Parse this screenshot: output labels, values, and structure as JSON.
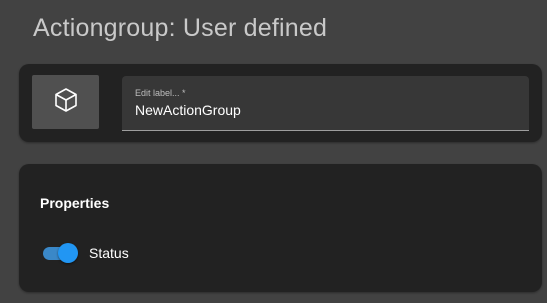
{
  "header": {
    "title": "Actiongroup: User defined"
  },
  "label_panel": {
    "icon": "cube-icon",
    "field": {
      "label": "Edit label... *",
      "value": "NewActionGroup"
    }
  },
  "properties": {
    "heading": "Properties",
    "status_toggle": {
      "label": "Status",
      "on": true,
      "accent_color": "#2196f3"
    }
  },
  "colors": {
    "page_background": "#424242",
    "panel_background": "#222222"
  }
}
